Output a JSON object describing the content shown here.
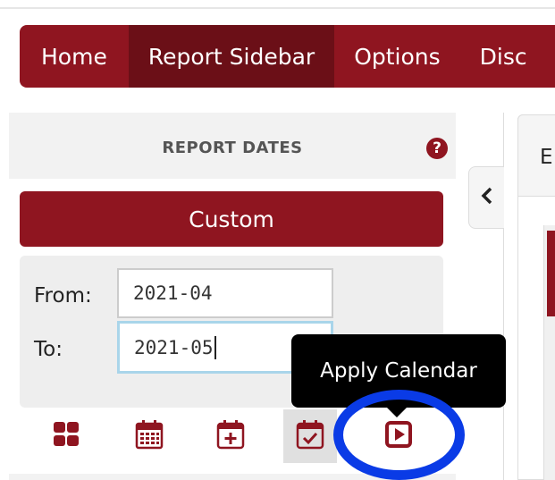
{
  "navbar": {
    "items": [
      {
        "label": "Home",
        "active": false
      },
      {
        "label": "Report Sidebar",
        "active": true
      },
      {
        "label": "Options",
        "active": false
      },
      {
        "label": "Disc",
        "active": false
      }
    ]
  },
  "report_dates": {
    "title": "REPORT DATES",
    "help_icon": "question-circle-icon",
    "mode_button": "Custom",
    "from_label": "From:",
    "from_value": "2021-04",
    "to_label": "To:",
    "to_value": "2021-05"
  },
  "toolbar": {
    "buttons": [
      {
        "icon": "grid-icon"
      },
      {
        "icon": "calendar-grid-icon"
      },
      {
        "icon": "calendar-plus-icon"
      },
      {
        "icon": "calendar-check-icon",
        "pressed": true
      },
      {
        "icon": "play-square-icon"
      }
    ]
  },
  "tooltip": {
    "text": "Apply Calendar"
  },
  "collapse": {
    "icon": "chevron-left-icon"
  },
  "report_panel": {
    "heading_partial": "E"
  },
  "colors": {
    "brand": "#8f1520",
    "brand_dark": "#6b0f17",
    "highlight": "#0a3be6",
    "focus": "#a9d5ea"
  }
}
